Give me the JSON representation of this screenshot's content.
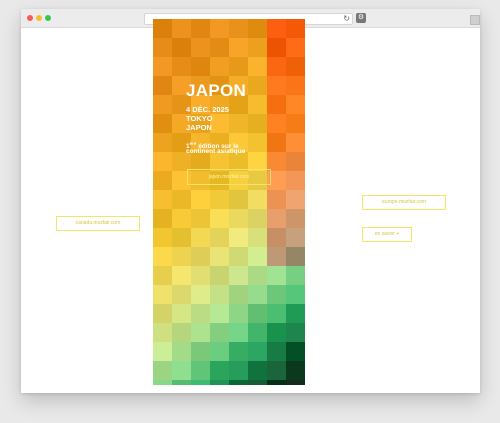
{
  "browser": {
    "reload_icon": "↻",
    "extension_icon": "⚙"
  },
  "poster": {
    "title": "JAPON",
    "date": "4 DÉC. 2025",
    "city": "TOKYO",
    "country": "JAPON",
    "edition_number": "1",
    "edition_suffix": "ère",
    "edition_text": " édition sur le",
    "continent_text": "continent asiatique",
    "link_label": "japon.mozfair.com"
  },
  "side_links": {
    "left": "canada.mozfair.com",
    "right_top": "europe.mozfair.com",
    "right_bottom": "en savoir +"
  },
  "colors": {
    "accent_border": "#f3e46a",
    "poster_orange": "#e8921a",
    "poster_green": "#2fa860"
  }
}
